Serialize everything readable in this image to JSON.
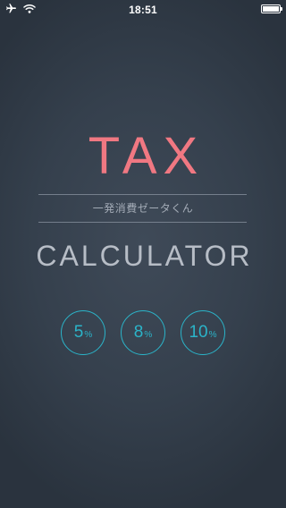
{
  "status_bar": {
    "time": "18:51",
    "icons": [
      "airplane-icon",
      "wifi-icon",
      "battery-icon"
    ]
  },
  "app": {
    "title_main": "TAX",
    "subtitle": "一発消費ゼータくん",
    "title_sub": "CALCULATOR"
  },
  "rate_buttons": [
    {
      "value": "5",
      "unit": "%"
    },
    {
      "value": "8",
      "unit": "%"
    },
    {
      "value": "10",
      "unit": "%"
    }
  ],
  "colors": {
    "background": "#36414e",
    "title_main": "#f07882",
    "title_sub": "#b7bdc6",
    "accent": "#2bb4c9",
    "divider": "#8a93a0"
  }
}
